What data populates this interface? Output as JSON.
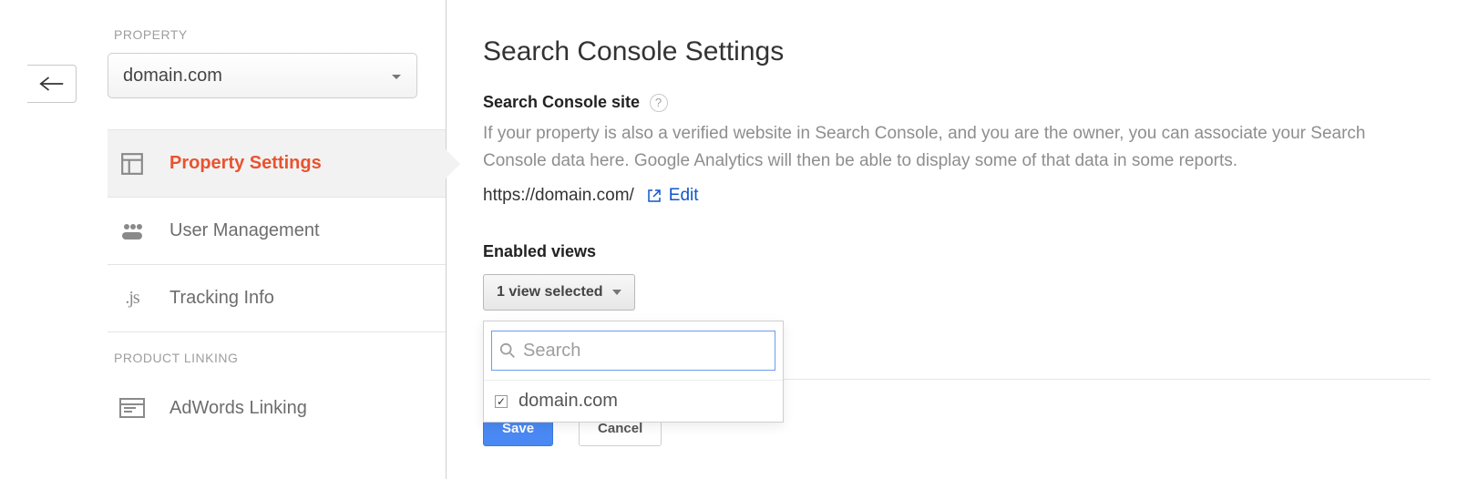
{
  "sidebar": {
    "section_property_label": "PROPERTY",
    "property_selected": "domain.com",
    "items": [
      {
        "label": "Property Settings"
      },
      {
        "label": "User Management"
      },
      {
        "label": "Tracking Info"
      }
    ],
    "section_product_linking_label": "PRODUCT LINKING",
    "product_linking_items": [
      {
        "label": "AdWords Linking"
      }
    ]
  },
  "main": {
    "title": "Search Console Settings",
    "site_label": "Search Console site",
    "site_desc": "If your property is also a verified website in Search Console, and you are the owner, you can associate your Search Console data here. Google Analytics will then be able to display some of that data in some reports.",
    "site_url": "https://domain.com/",
    "edit_label": "Edit",
    "enabled_views_label": "Enabled views",
    "view_select_label": "1 view selected",
    "dropdown": {
      "search_placeholder": "Search",
      "options": [
        {
          "label": "domain.com",
          "checked": true
        }
      ]
    },
    "actions": {
      "save": "Save",
      "cancel": "Cancel"
    }
  }
}
